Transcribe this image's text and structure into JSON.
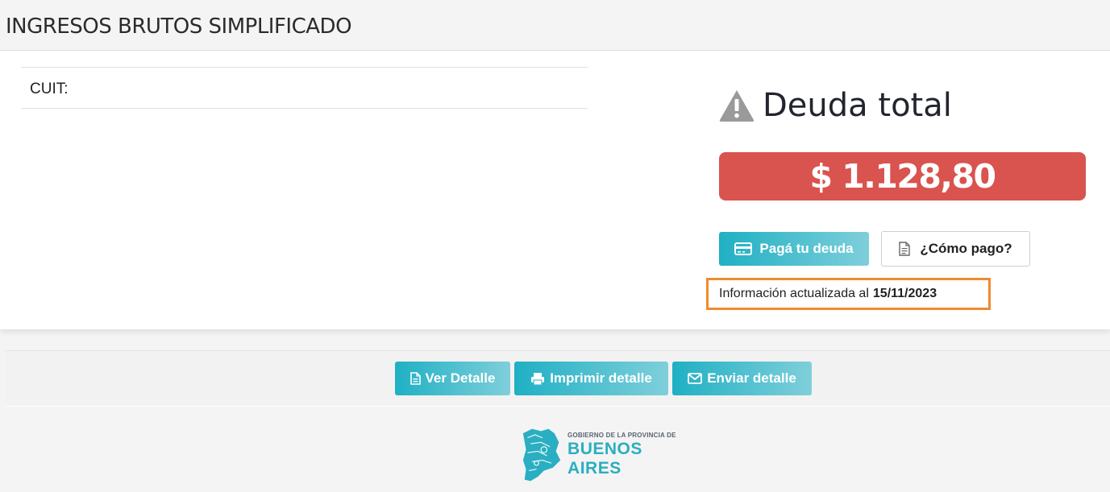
{
  "header": {
    "title": "INGRESOS BRUTOS SIMPLIFICADO"
  },
  "account": {
    "cuit_label": "CUIT:"
  },
  "debt": {
    "title": "Deuda total",
    "amount": "$ 1.128,80",
    "warning_icon": "warning-triangle-icon",
    "amount_color": "#d9534f"
  },
  "buttons": {
    "pay_label": "Pagá tu deuda",
    "pay_icon": "credit-card-icon",
    "how_label": "¿Cómo pago?",
    "how_icon": "document-icon",
    "accent_color": "#1fb0c4"
  },
  "info": {
    "prefix": "Información actualizada al",
    "date": "15/11/2023"
  },
  "actions": {
    "view_label": "Ver Detalle",
    "view_icon": "file-text-icon",
    "print_label": "Imprimir detalle",
    "print_icon": "printer-icon",
    "send_label": "Enviar detalle",
    "send_icon": "envelope-icon"
  },
  "footer": {
    "logo_line1": "GOBIERNO DE LA PROVINCIA DE",
    "logo_line2": "BUENOS AIRES"
  }
}
